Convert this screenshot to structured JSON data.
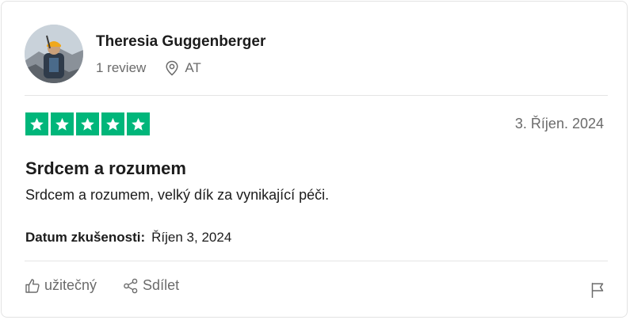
{
  "reviewer": {
    "name": "Theresia Guggenberger",
    "review_count": "1 review",
    "country": "AT"
  },
  "review": {
    "rating": 5,
    "date": "3. Říjen. 2024",
    "title": "Srdcem a rozumem",
    "body": "Srdcem a rozumem, velký dík za vynikající péči.",
    "experience_label": "Datum zkušenosti:",
    "experience_date": "Říjen 3, 2024"
  },
  "actions": {
    "useful_label": "užitečný",
    "share_label": "Sdílet"
  },
  "colors": {
    "star_fill": "#00b67a",
    "muted_text": "#6b6b6b"
  },
  "icons": [
    "location-pin-icon",
    "star-icon",
    "thumbs-up-icon",
    "share-icon",
    "flag-icon"
  ]
}
